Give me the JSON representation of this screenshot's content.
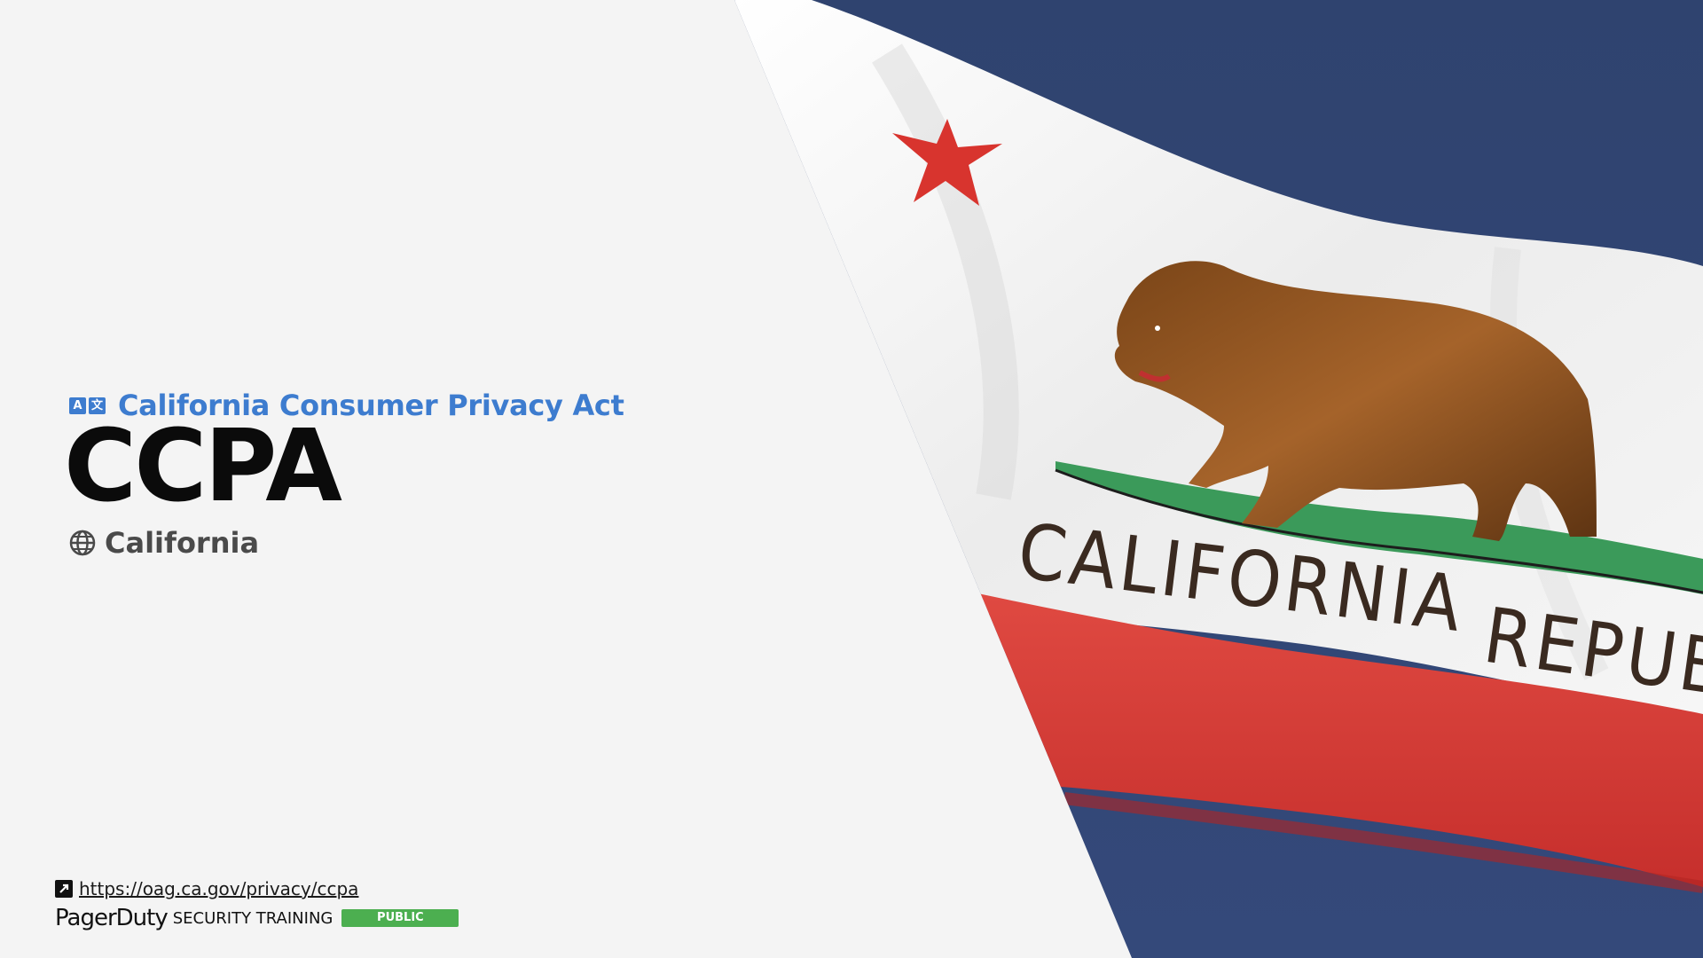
{
  "slide": {
    "subtitle": "California Consumer Privacy Act",
    "title": "CCPA",
    "region": "California",
    "link": "https://oag.ca.gov/privacy/ccpa"
  },
  "footer": {
    "brand": "PagerDuty",
    "training": "SECURITY TRAINING",
    "badge": "PUBLIC"
  },
  "flag": {
    "text": "CALIFORNIA  REPUBLIC",
    "icon": "california-bear-flag"
  },
  "colors": {
    "accent": "#3d7ccf",
    "sky": "#324570",
    "flag_red": "#d23a35",
    "flag_white": "#f2f2f2",
    "badge_green": "#4caf50"
  },
  "icons": {
    "subtitle_icon": "translate-icon",
    "region_icon": "globe-icon",
    "link_icon": "external-link-icon"
  }
}
